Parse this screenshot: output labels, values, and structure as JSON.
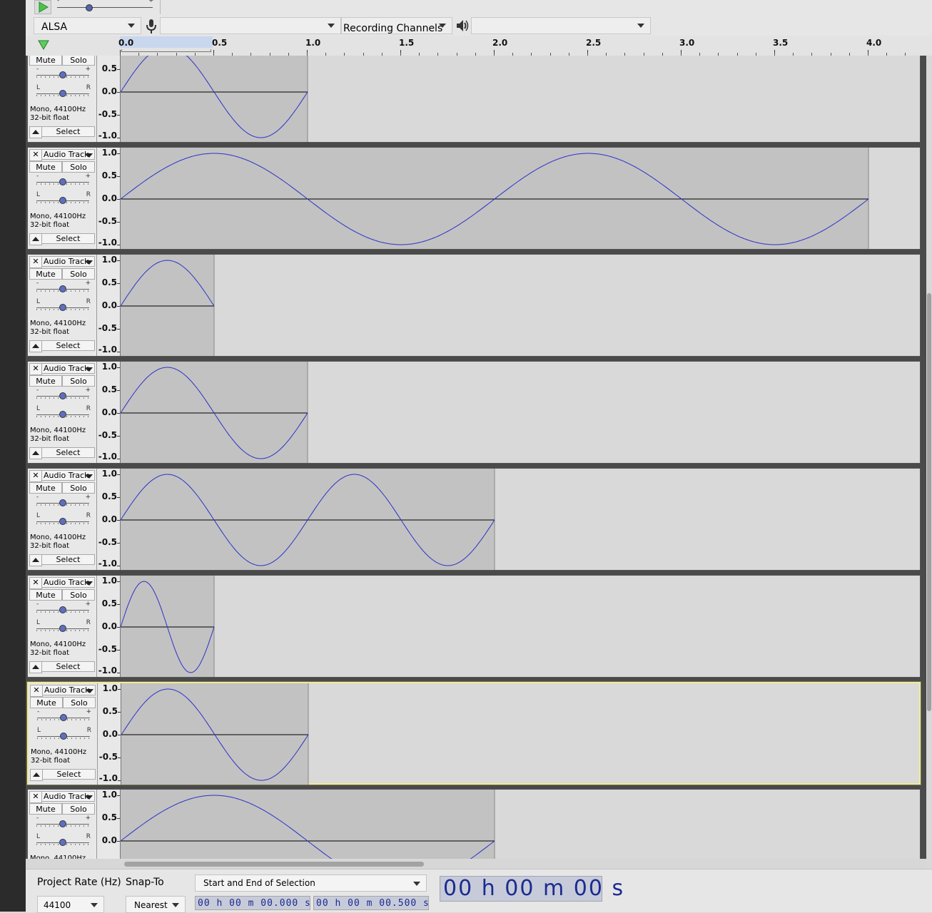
{
  "toolbar": {
    "play_icon": "play-icon",
    "speed_min": "-",
    "speed_max": "+"
  },
  "device": {
    "host": "ALSA",
    "recording_device": "",
    "recording_channels": "Recording Channels",
    "playback_device": "",
    "mic_icon": "microphone-icon",
    "speaker_icon": "speaker-icon"
  },
  "ruler": {
    "labels": [
      "0.0",
      "0.5",
      "1.0",
      "1.5",
      "2.0",
      "2.5",
      "3.0",
      "3.5",
      "4.0"
    ],
    "selection_start": 0.0,
    "selection_end": 0.5
  },
  "track_common": {
    "name": "Audio Track",
    "mute": "Mute",
    "solo": "Solo",
    "gain_minus": "-",
    "gain_plus": "+",
    "pan_left": "L",
    "pan_right": "R",
    "format_line1": "Mono, 44100Hz",
    "format_line2": "32-bit float",
    "select": "Select",
    "vruler": [
      "1.0",
      "0.5",
      "0.0",
      "-0.5",
      "-1.0"
    ]
  },
  "tracks": [
    {
      "duration": 1.0,
      "cycles": 1,
      "focused": false
    },
    {
      "duration": 4.0,
      "cycles": 2,
      "focused": false
    },
    {
      "duration": 0.5,
      "cycles": 0.5,
      "focused": false
    },
    {
      "duration": 1.0,
      "cycles": 1,
      "focused": false
    },
    {
      "duration": 2.0,
      "cycles": 2,
      "focused": false
    },
    {
      "duration": 0.5,
      "cycles": 1,
      "focused": false
    },
    {
      "duration": 1.0,
      "cycles": 1,
      "focused": true
    },
    {
      "duration": 2.0,
      "cycles": 1,
      "focused": false
    }
  ],
  "colors": {
    "waveform": "#2b32c8",
    "focus_border": "#efec97",
    "time_text": "#1b2b8f"
  },
  "bottom": {
    "project_rate_label": "Project Rate (Hz)",
    "project_rate_value": "44100",
    "snap_to_label": "Snap-To",
    "snap_to_value": "Nearest",
    "selection_format": "Start and End of Selection",
    "start_time": "00 h 00 m 00.000 s",
    "end_time": "00 h 00 m 00.500 s",
    "audio_position": "00 h 00 m 00 s"
  }
}
